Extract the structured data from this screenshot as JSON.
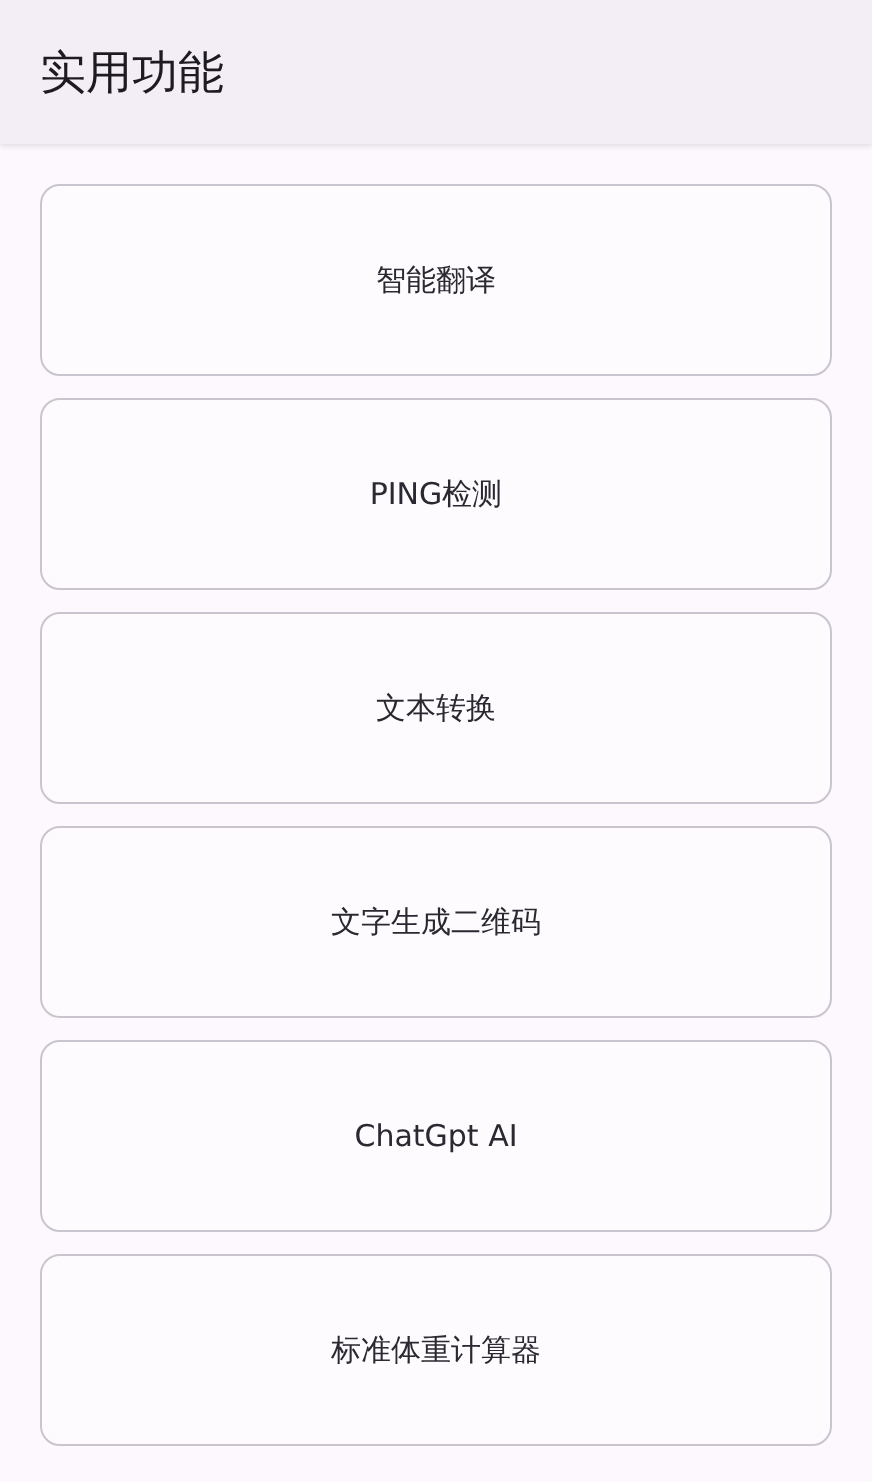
{
  "app_bar": {
    "title": "实用功能"
  },
  "features": [
    {
      "label": "智能翻译"
    },
    {
      "label": "PING检测"
    },
    {
      "label": "文本转换"
    },
    {
      "label": "文字生成二维码"
    },
    {
      "label": "ChatGpt AI"
    },
    {
      "label": "标准体重计算器"
    }
  ]
}
